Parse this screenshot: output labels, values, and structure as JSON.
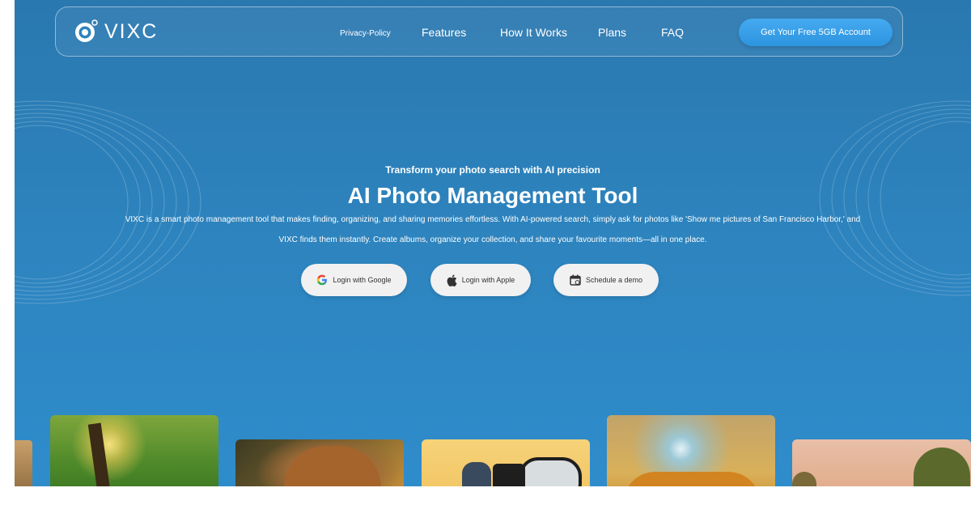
{
  "nav": {
    "logo_text": "VIXC",
    "links": [
      "Privacy-Policy",
      "Features",
      "How It Works",
      "Plans",
      "FAQ"
    ],
    "cta_label": "Get Your Free 5GB Account"
  },
  "hero": {
    "tagline": "Transform your photo search with AI precision",
    "title": "AI Photo Management Tool",
    "description_line1": "VIXC is a smart photo management tool that makes finding, organizing, and sharing memories effortless. With AI-powered search, simply ask for photos like 'Show me pictures of San Francisco Harbor,' and",
    "description_line2": "VIXC finds them instantly. Create albums, organize your collection, and share your favourite moments—all in one place.",
    "buttons": {
      "google": "Login with Google",
      "apple": "Login with Apple",
      "demo": "Schedule a demo"
    }
  },
  "colors": {
    "hero_background": "#2d83bd",
    "cta_button": "#3ba0ea",
    "button_bg": "#f1f1f1"
  },
  "icons": [
    "eye-logo-icon",
    "google-icon",
    "apple-icon",
    "calendar-icon"
  ]
}
